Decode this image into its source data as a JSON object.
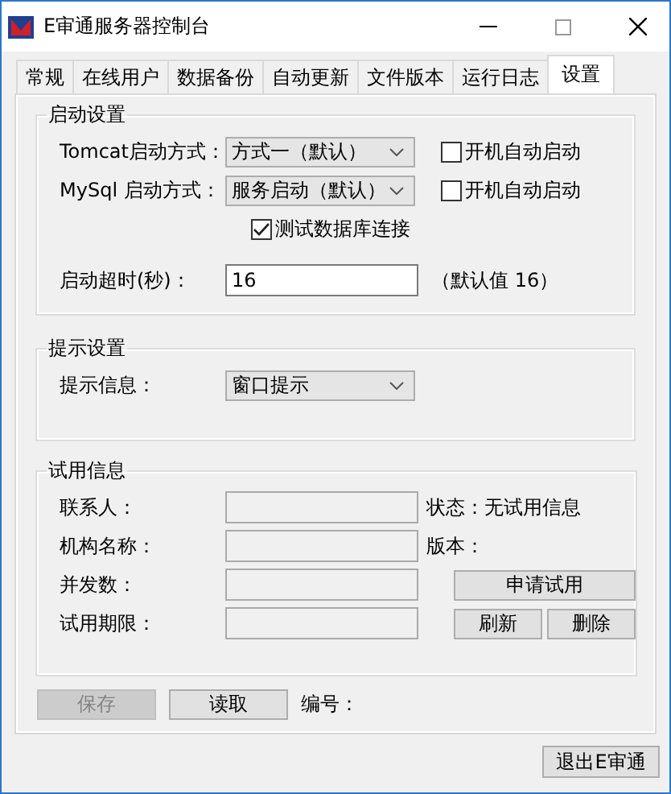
{
  "window": {
    "title": "E审通服务器控制台"
  },
  "tabs": [
    {
      "label": "常规",
      "selected": false
    },
    {
      "label": "在线用户",
      "selected": false
    },
    {
      "label": "数据备份",
      "selected": false
    },
    {
      "label": "自动更新",
      "selected": false
    },
    {
      "label": "文件版本",
      "selected": false
    },
    {
      "label": "运行日志",
      "selected": false
    },
    {
      "label": "设置",
      "selected": true
    }
  ],
  "startup_settings": {
    "title": "启动设置",
    "services": [
      {
        "label": "Tomcat启动方式：",
        "value": "方式一（默认）",
        "autostart": {
          "label": "开机自动启动",
          "checked": false
        }
      },
      {
        "label": "MySql 启动方式：",
        "value": "服务启动（默认）",
        "autostart": {
          "label": "开机自动启动",
          "checked": false
        }
      }
    ],
    "test_connection": {
      "label": "测试数据库连接",
      "checked": true
    },
    "timeout": {
      "label": "启动超时(秒)：",
      "value": "16",
      "hint": "（默认值 16）"
    }
  },
  "prompt_settings": {
    "title": "提示设置",
    "label": "提示信息：",
    "value": "窗口提示"
  },
  "trial_info": {
    "title": "试用信息",
    "fields": [
      {
        "label": "联系人："
      },
      {
        "label": "机构名称："
      },
      {
        "label": "并发数："
      },
      {
        "label": "试用期限："
      }
    ],
    "status": "状态：无试用信息",
    "version": "版本：",
    "buttons": [
      {
        "label": "申请试用"
      },
      {
        "label": "刷新"
      },
      {
        "label": "删除"
      }
    ]
  },
  "footer": {
    "buttons": [
      {
        "label": "保存",
        "disabled": true
      },
      {
        "label": "读取",
        "disabled": false
      }
    ],
    "serial_label": "编号："
  },
  "exit_button": {
    "label": "退出E审通"
  }
}
